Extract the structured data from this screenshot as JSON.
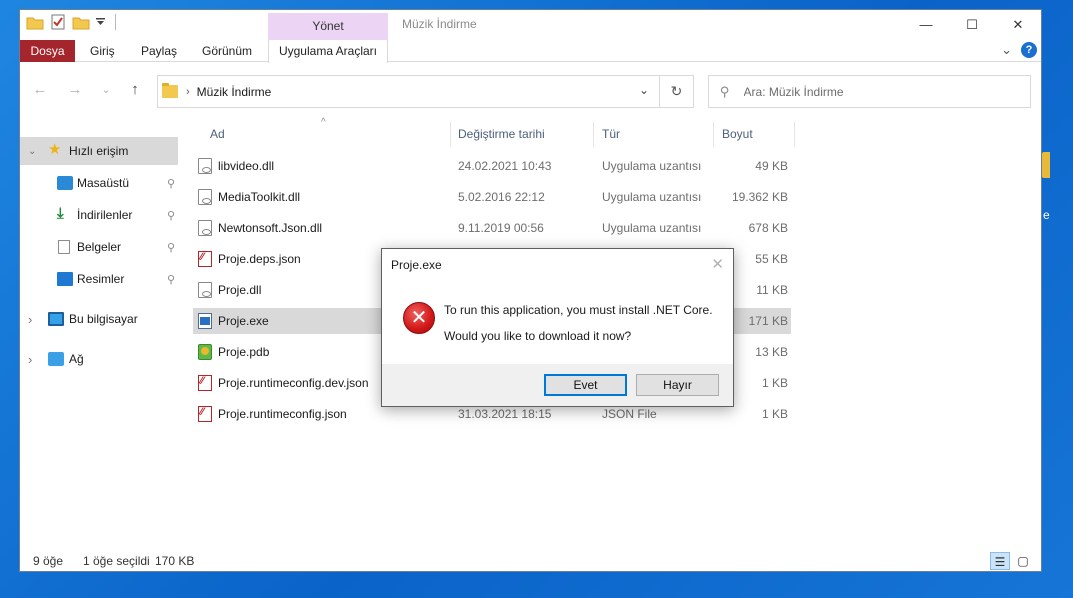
{
  "window": {
    "title": "Müzik İndirme",
    "context_tab_group": "Yönet",
    "controls": {
      "minimize": "—",
      "maximize": "☐",
      "close": "✕"
    }
  },
  "ribbon": {
    "tabs": [
      "Dosya",
      "Giriş",
      "Paylaş",
      "Görünüm",
      "Uygulama Araçları"
    ],
    "active_tab": "Dosya",
    "help": "?",
    "collapse": "⌄"
  },
  "navigation": {
    "back": "←",
    "forward": "→",
    "recent": "⌄",
    "up": "↑",
    "address_path": "Müzik İndirme",
    "address_chevron": "›",
    "dropdown": "⌄",
    "refresh": "↻",
    "search_placeholder": "Ara: Müzik İndirme"
  },
  "sidebar": {
    "quick_access": {
      "label": "Hızlı erişim",
      "expanded": true,
      "icon": "star-icon"
    },
    "pinned": [
      {
        "label": "Masaüstü",
        "icon": "desktop-icon"
      },
      {
        "label": "İndirilenler",
        "icon": "download-icon"
      },
      {
        "label": "Belgeler",
        "icon": "documents-icon"
      },
      {
        "label": "Resimler",
        "icon": "pictures-icon"
      }
    ],
    "this_pc": {
      "label": "Bu bilgisayar",
      "icon": "computer-icon"
    },
    "network": {
      "label": "Ağ",
      "icon": "network-icon"
    },
    "pin_glyph": "📌",
    "expand_glyph": "›",
    "expanded_glyph": "⌄"
  },
  "file_list": {
    "columns": {
      "name": "Ad",
      "modified": "Değiştirme tarihi",
      "type": "Tür",
      "size": "Boyut"
    },
    "sort_glyph": "^",
    "files": [
      {
        "name": "libvideo.dll",
        "modified": "24.02.2021 10:43",
        "type": "Uygulama uzantısı",
        "size": "49 KB",
        "icon": "dll-file-icon"
      },
      {
        "name": "MediaToolkit.dll",
        "modified": "5.02.2016 22:12",
        "type": "Uygulama uzantısı",
        "size": "19.362 KB",
        "icon": "dll-file-icon"
      },
      {
        "name": "Newtonsoft.Json.dll",
        "modified": "9.11.2019 00:56",
        "type": "Uygulama uzantısı",
        "size": "678 KB",
        "icon": "dll-file-icon"
      },
      {
        "name": "Proje.deps.json",
        "modified": "",
        "type": "",
        "size": "55 KB",
        "icon": "json-file-icon"
      },
      {
        "name": "Proje.dll",
        "modified": "",
        "type": "",
        "size": "11 KB",
        "icon": "dll-file-icon"
      },
      {
        "name": "Proje.exe",
        "modified": "",
        "type": "",
        "size": "171 KB",
        "icon": "exe-file-icon",
        "selected": true
      },
      {
        "name": "Proje.pdb",
        "modified": "",
        "type": "",
        "size": "13 KB",
        "icon": "pdb-file-icon"
      },
      {
        "name": "Proje.runtimeconfig.dev.json",
        "modified": "",
        "type": "",
        "size": "1 KB",
        "icon": "json-file-icon"
      },
      {
        "name": "Proje.runtimeconfig.json",
        "modified": "31.03.2021 18:15",
        "type": "JSON File",
        "size": "1 KB",
        "icon": "json-file-icon"
      }
    ]
  },
  "status_bar": {
    "item_count": "9 öğe",
    "selection": "1 öğe seçildi",
    "selection_size": "170 KB"
  },
  "dialog": {
    "title": "Proje.exe",
    "close": "✕",
    "icon": "error-icon",
    "message": "To run this application, you must install .NET Core.",
    "question": "Would you like to download it now?",
    "yes_button": "Evet",
    "no_button": "Hayır"
  },
  "desktop": {
    "edge_label": "e"
  }
}
